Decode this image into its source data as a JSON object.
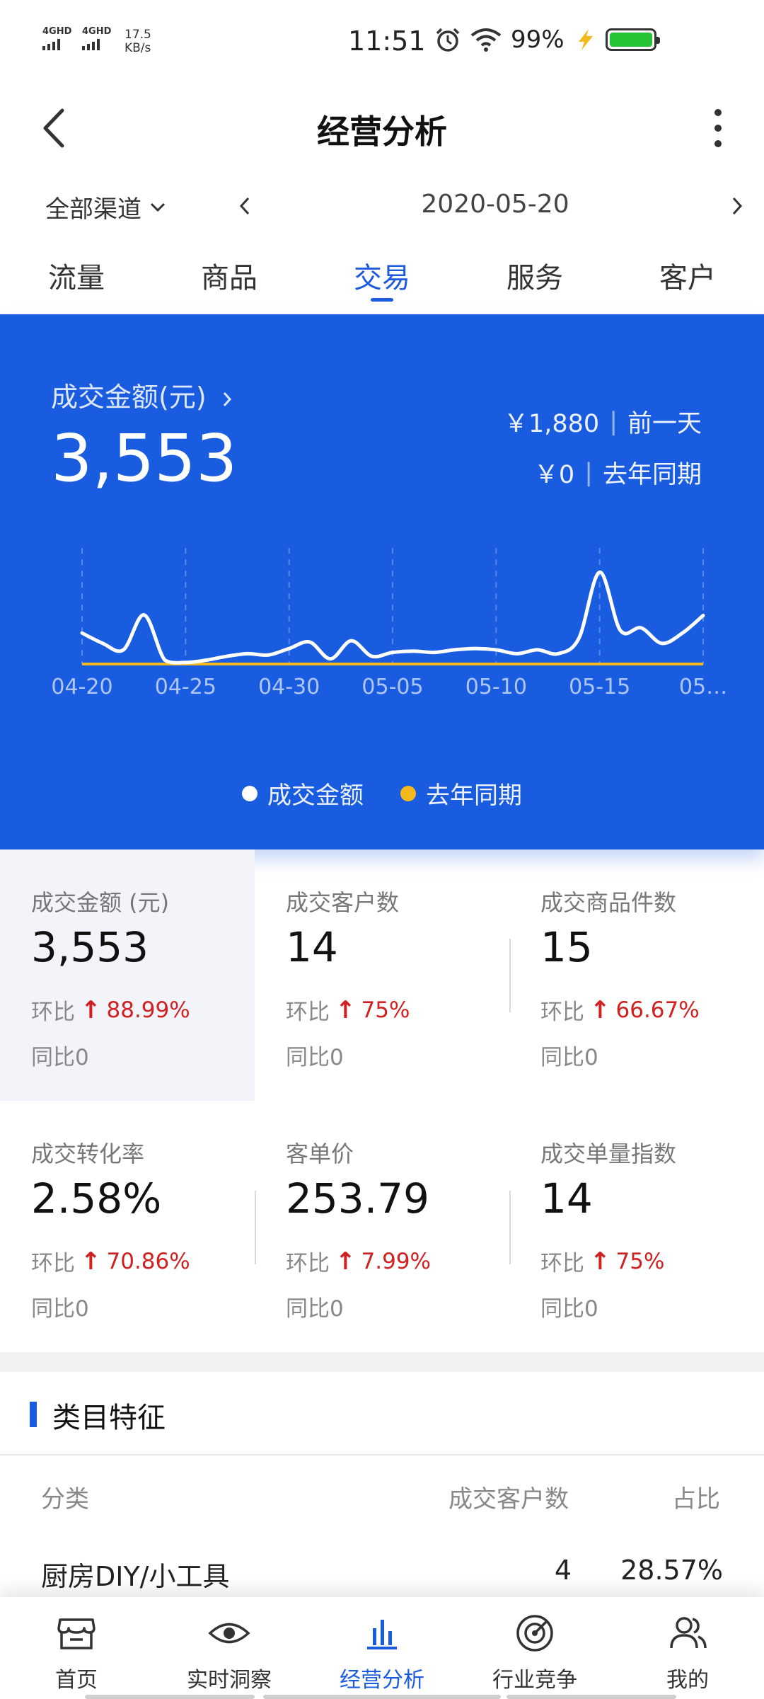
{
  "status_bar": {
    "signal_1": "4GHD",
    "signal_2": "4GHD",
    "net_speed": "17.5",
    "net_speed_unit": "KB/s",
    "time": "11:51",
    "battery_pct": "99%"
  },
  "header": {
    "title": "经营分析"
  },
  "filter": {
    "channel": "全部渠道",
    "date": "2020-05-20"
  },
  "tabs": [
    "流量",
    "商品",
    "交易",
    "服务",
    "客户"
  ],
  "active_tab": "交易",
  "hero": {
    "label": "成交金额(元)",
    "value": "3,553",
    "prev_day_value": "￥1,880",
    "prev_day_label": "前一天",
    "last_year_value": "￥0",
    "last_year_label": "去年同期"
  },
  "chart_data": {
    "type": "line",
    "x_ticks": [
      "04-20",
      "04-25",
      "04-30",
      "05-05",
      "05-10",
      "05-15",
      "05…"
    ],
    "series": [
      {
        "name": "成交金额",
        "color": "#ffffff",
        "x": [
          "04-20",
          "04-21",
          "04-22",
          "04-23",
          "04-24",
          "04-25",
          "04-26",
          "04-27",
          "04-28",
          "04-29",
          "04-30",
          "05-01",
          "05-02",
          "05-03",
          "05-04",
          "05-05",
          "05-06",
          "05-07",
          "05-08",
          "05-09",
          "05-10",
          "05-11",
          "05-12",
          "05-13",
          "05-14",
          "05-15",
          "05-16",
          "05-17",
          "05-18",
          "05-19",
          "05-20"
        ],
        "values": [
          1200,
          800,
          550,
          1900,
          150,
          60,
          150,
          300,
          400,
          350,
          600,
          850,
          200,
          900,
          300,
          450,
          500,
          450,
          550,
          600,
          550,
          400,
          550,
          400,
          1000,
          3553,
          1300,
          1400,
          800,
          1200,
          1880
        ]
      },
      {
        "name": "去年同期",
        "color": "#f5b91e",
        "x": [
          "04-20",
          "05-20"
        ],
        "values": [
          0,
          0
        ]
      }
    ],
    "ylim": [
      0,
      4000
    ],
    "legend": "bottom-center"
  },
  "legend": {
    "item_1": "成交金额",
    "item_2": "去年同期"
  },
  "metrics": [
    {
      "label": "成交金额 (元)",
      "value": "3,553",
      "mom_label": "环比",
      "mom": "88.99%",
      "yoy": "同比0"
    },
    {
      "label": "成交客户数",
      "value": "14",
      "mom_label": "环比",
      "mom": "75%",
      "yoy": "同比0"
    },
    {
      "label": "成交商品件数",
      "value": "15",
      "mom_label": "环比",
      "mom": "66.67%",
      "yoy": "同比0"
    },
    {
      "label": "成交转化率",
      "value": "2.58%",
      "mom_label": "环比",
      "mom": "70.86%",
      "yoy": "同比0"
    },
    {
      "label": "客单价",
      "value": "253.79",
      "mom_label": "环比",
      "mom": "7.99%",
      "yoy": "同比0"
    },
    {
      "label": "成交单量指数",
      "value": "14",
      "mom_label": "环比",
      "mom": "75%",
      "yoy": "同比0"
    }
  ],
  "category": {
    "title": "类目特征",
    "col_category": "分类",
    "col_customers": "成交客户数",
    "col_share": "占比",
    "rows": [
      {
        "name": "厨房DIY/小工具",
        "customers": "4",
        "share": "28.57%"
      }
    ]
  },
  "bottom_nav": [
    {
      "label": "首页",
      "icon": "store-icon"
    },
    {
      "label": "实时洞察",
      "icon": "eye-icon"
    },
    {
      "label": "经营分析",
      "icon": "bar-chart-icon"
    },
    {
      "label": "行业竞争",
      "icon": "radar-icon"
    },
    {
      "label": "我的",
      "icon": "user-icon"
    }
  ],
  "colors": {
    "accent": "#1a5ce0",
    "up": "#d02020",
    "last_year": "#f5b91e"
  }
}
